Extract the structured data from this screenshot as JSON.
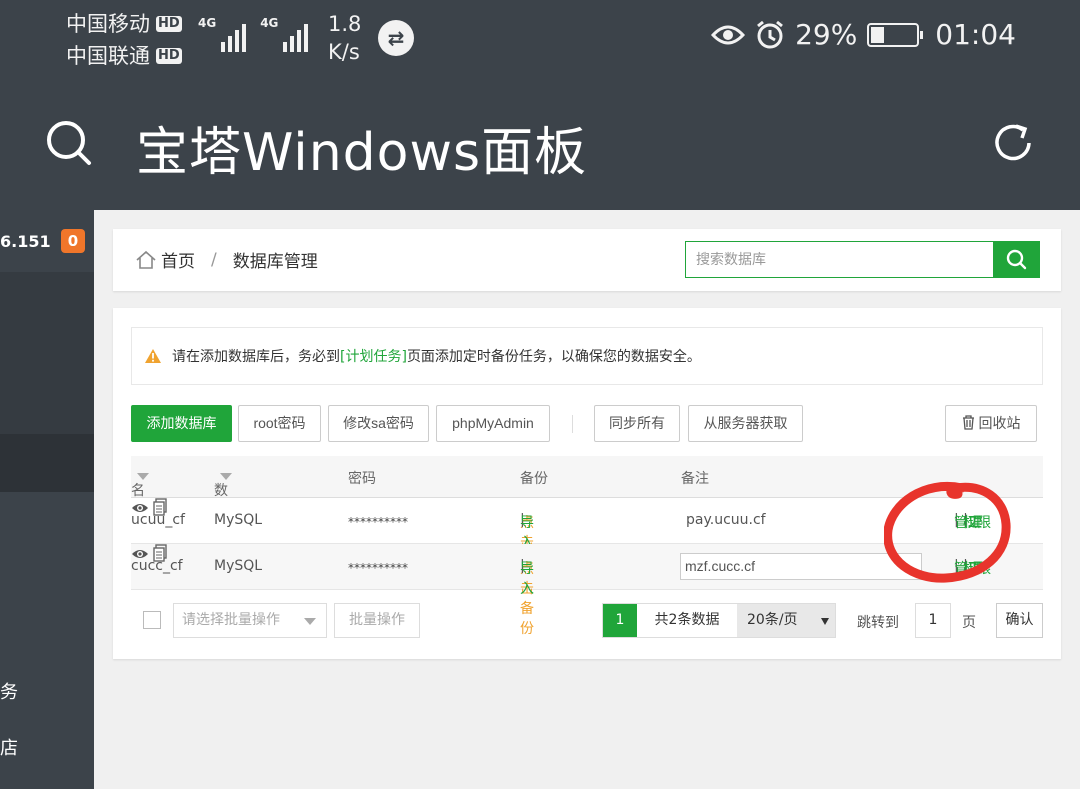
{
  "status_bar": {
    "carrier1": "中国移动",
    "carrier2": "中国联通",
    "hd": "HD",
    "net_type": "4G",
    "speed_value": "1.8",
    "speed_unit": "K/s",
    "battery_text": "29%",
    "battery_level": 0.29,
    "time": "01:04"
  },
  "app_bar": {
    "title": "宝塔Windows面板",
    "search_icon": "search-icon",
    "refresh_icon": "refresh-icon"
  },
  "sidebar": {
    "ip_fragment": "6.151",
    "badge_count": "0",
    "item_partial_1": "务",
    "item_partial_2": "店"
  },
  "breadcrumb": {
    "home": "首页",
    "separator": "/",
    "current": "数据库管理"
  },
  "search": {
    "placeholder": "搜索数据库"
  },
  "notice": {
    "before": "请在添加数据库后，务必到",
    "link": "[计划任务]",
    "after": "页面添加定时备份任务，以确保您的数据安全。"
  },
  "toolbar": {
    "add": "添加数据库",
    "root_pw": "root密码",
    "sa_pw": "修改sa密码",
    "phpmyadmin": "phpMyAdmin",
    "sync_all": "同步所有",
    "fetch_server": "从服务器获取",
    "recycle": "回收站"
  },
  "table": {
    "headers": {
      "name": "名",
      "type": "数据库类型",
      "password": "密码",
      "backup": "备份",
      "note": "备注"
    },
    "rows": [
      {
        "name": "ucuu_cf",
        "type": "MySQL",
        "password": "**********",
        "backup_link": "点击备份",
        "sep": "|",
        "import_link": "导入",
        "note": "pay.ucuu.cf",
        "action_manage": "管理",
        "action_perm": "权限",
        "action_extra": "工"
      },
      {
        "name": "cucc_cf",
        "type": "MySQL",
        "password": "**********",
        "backup_link": "点击备份",
        "sep": "|",
        "import_link": "导入",
        "note": "mzf.cucc.cf",
        "action_manage": "管理",
        "action_perm": "权限",
        "action_extra": "工"
      }
    ]
  },
  "footer": {
    "batch_select_placeholder": "请选择批量操作",
    "batch_button": "批量操作",
    "current_page": "1",
    "total": "共2条数据",
    "page_size": "20条/页",
    "jump_label": "跳转到",
    "jump_value": "1",
    "page_word": "页",
    "confirm": "确认"
  },
  "colors": {
    "brand_green": "#20a53a",
    "dark_bg": "#3c434a",
    "badge_orange": "#f0762a",
    "link_orange": "#f0a330",
    "annotation_red": "#e8342c"
  }
}
